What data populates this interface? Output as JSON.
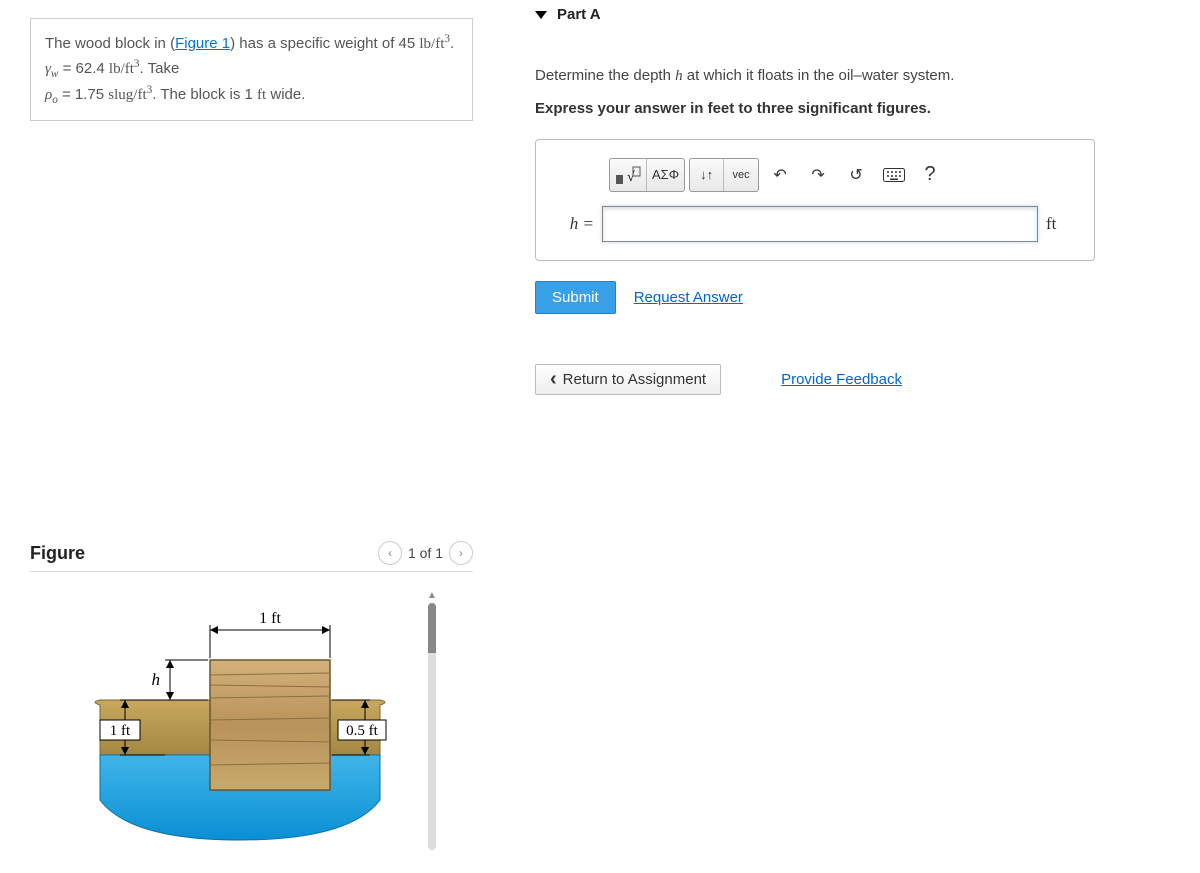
{
  "problem": {
    "pre_text": "The wood block in (",
    "figure_link": "Figure 1",
    "post_text": ") has a specific weight of 45 ",
    "unit1": "lb/ft",
    "gamma_label": "γ",
    "gamma_sub": "w",
    "gamma_eq": " = 62.4 ",
    "unit2": "lb/ft",
    "take": ". Take",
    "rho_label": "ρ",
    "rho_sub": "o",
    "rho_eq": " = 1.75 ",
    "unit3": "slug/ft",
    "tail": ". The block is 1 ",
    "tail_unit": "ft",
    "tail2": " wide."
  },
  "figure": {
    "title": "Figure",
    "page_indicator": "1 of 1",
    "dim_top": "1 ft",
    "dim_h": "h",
    "dim_left": "1 ft",
    "dim_right": "0.5 ft"
  },
  "part": {
    "header": "Part A",
    "prompt_pre": "Determine the depth ",
    "prompt_var": "h",
    "prompt_post": " at which it floats in the oil–water system.",
    "instruction": "Express your answer in feet to three significant figures.",
    "var_label": "h =",
    "unit": "ft",
    "toolbar": {
      "templates": "▯√▯",
      "greek": "ΑΣΦ",
      "vec_arrows": "↓↑",
      "vec": "vec",
      "undo": "↶",
      "redo": "↷",
      "reset": "↺",
      "keyboard": "⌨",
      "help": "?"
    },
    "submit": "Submit",
    "request": "Request Answer"
  },
  "nav": {
    "return": "Return to Assignment",
    "feedback": "Provide Feedback"
  }
}
